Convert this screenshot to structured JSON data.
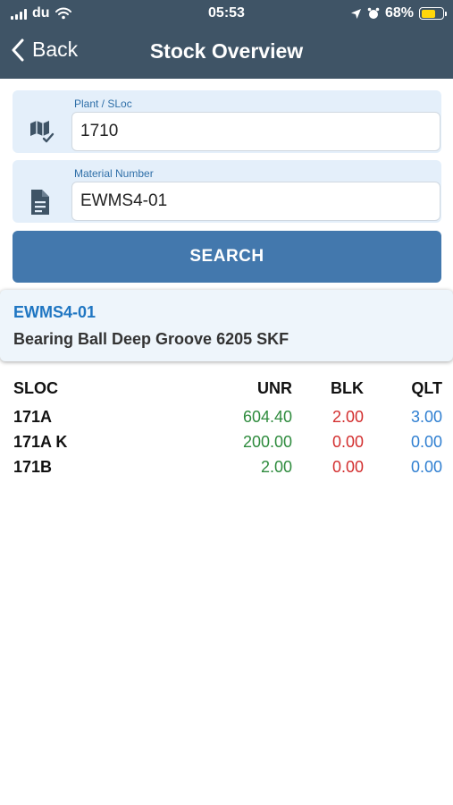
{
  "status_bar": {
    "carrier": "du",
    "time": "05:53",
    "battery": "68%",
    "battery_level": 0.68
  },
  "nav": {
    "back_label": "Back",
    "title": "Stock Overview"
  },
  "form": {
    "plant": {
      "label": "Plant / SLoc",
      "value": "1710"
    },
    "material": {
      "label": "Material Number",
      "value": "EWMS4-01"
    },
    "search_label": "SEARCH"
  },
  "result": {
    "material": "EWMS4-01",
    "description": "Bearing Ball Deep Groove 6205 SKF"
  },
  "table": {
    "headers": {
      "sloc": "SLOC",
      "unr": "UNR",
      "blk": "BLK",
      "qlt": "QLT"
    },
    "rows": [
      {
        "sloc": "171A",
        "unr": "604.40",
        "blk": "2.00",
        "qlt": "3.00"
      },
      {
        "sloc": "171A K",
        "unr": "200.00",
        "blk": "0.00",
        "qlt": "0.00"
      },
      {
        "sloc": "171B",
        "unr": "2.00",
        "blk": "0.00",
        "qlt": "0.00"
      }
    ]
  },
  "colors": {
    "header_bg": "#3f5466",
    "accent": "#4378ad",
    "unr_green": "#2e8b3d",
    "blk_red": "#d32f2f",
    "qlt_blue": "#2f7fd1",
    "material_blue": "#1f76c2"
  },
  "icons": {
    "plant": "map-check-icon",
    "material": "document-icon",
    "back": "chevron-left-icon",
    "location": "location-arrow-icon",
    "alarm": "alarm-clock-icon",
    "wifi": "wifi-icon"
  }
}
